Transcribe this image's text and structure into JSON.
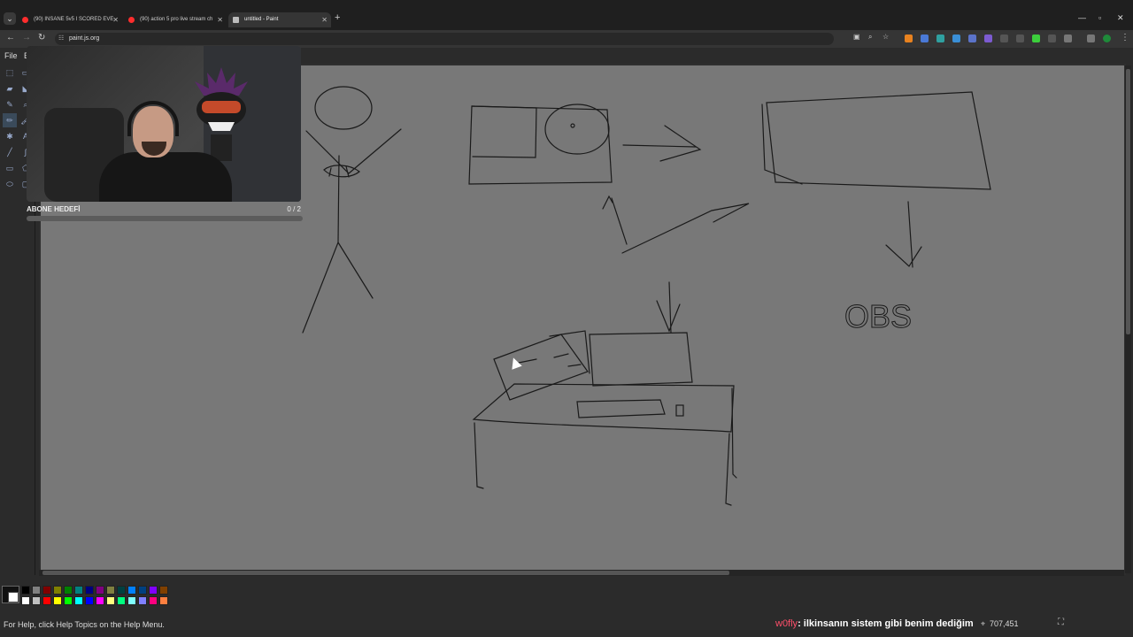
{
  "browser": {
    "tabs": [
      {
        "title": "(90) INSANE 5v5 I SCORED EVE",
        "favicon_color": "#ff2d2d",
        "active": false
      },
      {
        "title": "(90) action 5 pro live stream ch",
        "favicon_color": "#ff2d2d",
        "active": false
      },
      {
        "title": "untitled - Paint",
        "favicon_color": "#bbbbbb",
        "active": true
      }
    ],
    "new_tab_icon": "plus-icon",
    "url": "paint.js.org"
  },
  "paint": {
    "menu": [
      "File",
      "E"
    ],
    "status_help": "For Help, click Help Topics on the Help Menu.",
    "coordinates": "707,451",
    "palette_colors": [
      "#000000",
      "#808080",
      "#800000",
      "#808000",
      "#008000",
      "#008080",
      "#000080",
      "#800080",
      "#808040",
      "#004040",
      "#0080ff",
      "#004080",
      "#8000ff",
      "#804000",
      "#ffffff",
      "#c0c0c0",
      "#ff0000",
      "#ffff00",
      "#00ff00",
      "#00ffff",
      "#0000ff",
      "#ff00ff",
      "#ffff80",
      "#00ff80",
      "#80ffff",
      "#8080ff",
      "#ff0080",
      "#ff8040"
    ],
    "canvas_text": "OBS"
  },
  "stream": {
    "goal_label": "ABONE HEDEFİ",
    "goal_count": "0 / 2",
    "goal_progress": 0,
    "chat_user": "w0fly",
    "chat_message": ": ilkinsanın sistem gibi benim dediğim"
  }
}
